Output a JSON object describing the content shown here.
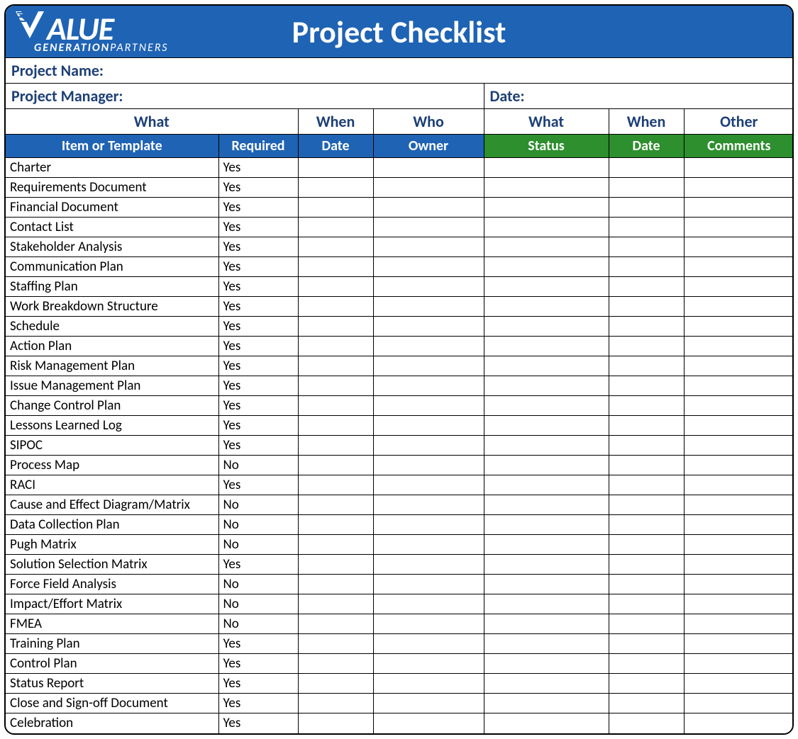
{
  "header": {
    "title": "Project Checklist",
    "logo_top": "ALUE",
    "logo_bottom_1": "GENERATION",
    "logo_bottom_2": "PARTNERS"
  },
  "meta": {
    "project_name_label": "Project Name:",
    "project_manager_label": "Project Manager:",
    "date_label": "Date:"
  },
  "group_headers": {
    "g1": "What",
    "g2": "When",
    "g3": "Who",
    "g4": "What",
    "g5": "When",
    "g6": "Other"
  },
  "sub_headers": {
    "s1": "Item or Template",
    "s2": "Required",
    "s3": "Date",
    "s4": "Owner",
    "s5": "Status",
    "s6": "Date",
    "s7": "Comments"
  },
  "rows": [
    {
      "item": "Charter",
      "required": "Yes"
    },
    {
      "item": "Requirements Document",
      "required": "Yes"
    },
    {
      "item": "Financial Document",
      "required": "Yes"
    },
    {
      "item": "Contact List",
      "required": "Yes"
    },
    {
      "item": "Stakeholder Analysis",
      "required": "Yes"
    },
    {
      "item": "Communication Plan",
      "required": "Yes"
    },
    {
      "item": "Staffing Plan",
      "required": "Yes"
    },
    {
      "item": "Work Breakdown Structure",
      "required": "Yes"
    },
    {
      "item": "Schedule",
      "required": "Yes"
    },
    {
      "item": "Action Plan",
      "required": "Yes"
    },
    {
      "item": "Risk Management Plan",
      "required": "Yes"
    },
    {
      "item": "Issue Management Plan",
      "required": "Yes"
    },
    {
      "item": "Change Control Plan",
      "required": "Yes"
    },
    {
      "item": "Lessons Learned Log",
      "required": "Yes"
    },
    {
      "item": "SIPOC",
      "required": "Yes"
    },
    {
      "item": "Process Map",
      "required": "No"
    },
    {
      "item": "RACI",
      "required": "Yes"
    },
    {
      "item": "Cause and Effect Diagram/Matrix",
      "required": "No"
    },
    {
      "item": "Data Collection Plan",
      "required": "No"
    },
    {
      "item": "Pugh Matrix",
      "required": "No"
    },
    {
      "item": "Solution Selection Matrix",
      "required": "Yes"
    },
    {
      "item": "Force Field Analysis",
      "required": "No"
    },
    {
      "item": "Impact/Effort Matrix",
      "required": "No"
    },
    {
      "item": "FMEA",
      "required": "No"
    },
    {
      "item": "Training Plan",
      "required": "Yes"
    },
    {
      "item": "Control Plan",
      "required": "Yes"
    },
    {
      "item": "Status Report",
      "required": "Yes"
    },
    {
      "item": "Close and Sign-off Document",
      "required": "Yes"
    },
    {
      "item": "Celebration",
      "required": "Yes"
    }
  ]
}
